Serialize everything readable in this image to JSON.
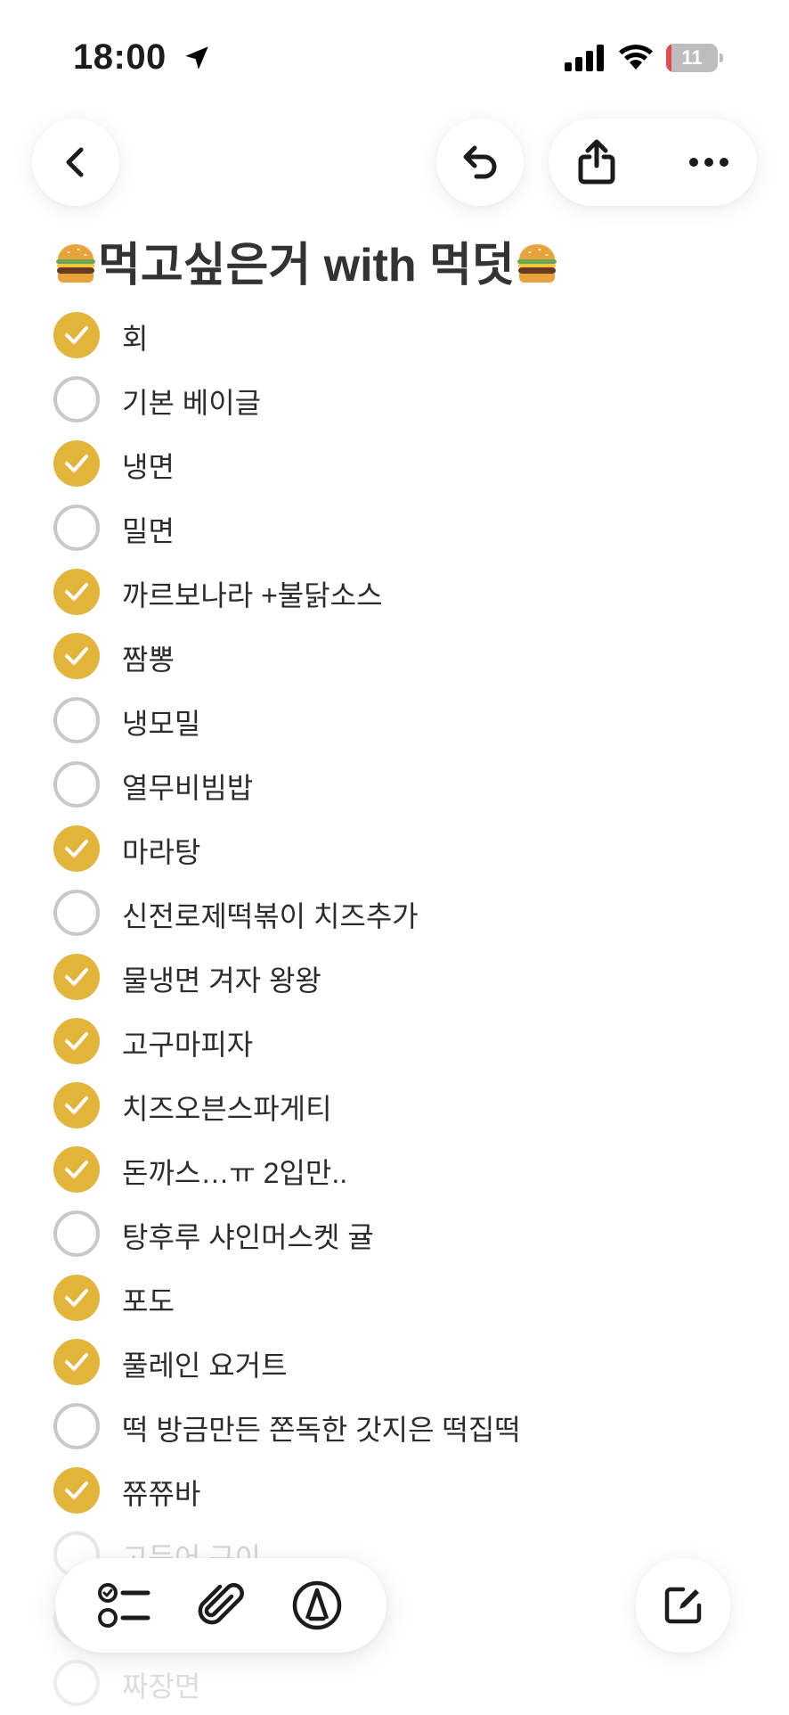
{
  "status_bar": {
    "time": "18:00",
    "battery_level": "11",
    "battery_fraction": 0.11,
    "icons": [
      "location-arrow-icon",
      "signal-icon",
      "wifi-icon",
      "battery-icon"
    ]
  },
  "toolbar": {
    "back_icon": "chevron-left-icon",
    "undo_icon": "undo-icon",
    "share_icon": "share-icon",
    "more_icon": "more-icon"
  },
  "note": {
    "title_text": "먹고싶은거 with 먹덧",
    "title_emoji": "hamburger",
    "items": [
      {
        "label": "회",
        "checked": true
      },
      {
        "label": "기본 베이글",
        "checked": false
      },
      {
        "label": "냉면",
        "checked": true
      },
      {
        "label": "밀면",
        "checked": false
      },
      {
        "label": "까르보나라 +불닭소스",
        "checked": true
      },
      {
        "label": "짬뽕",
        "checked": true
      },
      {
        "label": "냉모밀",
        "checked": false
      },
      {
        "label": "열무비빔밥",
        "checked": false
      },
      {
        "label": "마라탕",
        "checked": true
      },
      {
        "label": "신전로제떡볶이 치즈추가",
        "checked": false
      },
      {
        "label": "물냉면 겨자 왕왕",
        "checked": true
      },
      {
        "label": "고구마피자",
        "checked": true
      },
      {
        "label": "치즈오븐스파게티",
        "checked": true
      },
      {
        "label": "돈까스…ㅠ 2입만..",
        "checked": true
      },
      {
        "label": "탕후루 샤인머스켓 귤",
        "checked": false
      },
      {
        "label": "포도",
        "checked": true
      },
      {
        "label": "풀레인 요거트",
        "checked": true
      },
      {
        "label": "떡 방금만든 쫀독한 갓지은 떡집떡",
        "checked": false
      },
      {
        "label": "쮸쮸바",
        "checked": true
      },
      {
        "label": "고등어 구이",
        "checked": false
      },
      {
        "label": "",
        "checked": false
      },
      {
        "label": "짜장면",
        "checked": false
      }
    ]
  },
  "bottom_toolbar": {
    "tools": [
      "checklist-icon",
      "attachment-icon",
      "markup-icon"
    ],
    "compose_icon": "compose-icon"
  },
  "colors": {
    "accent": "#e2b43a",
    "unchecked_border": "#c8c8cc",
    "text": "#2c2c2e",
    "battery_low": "#e5484d"
  }
}
